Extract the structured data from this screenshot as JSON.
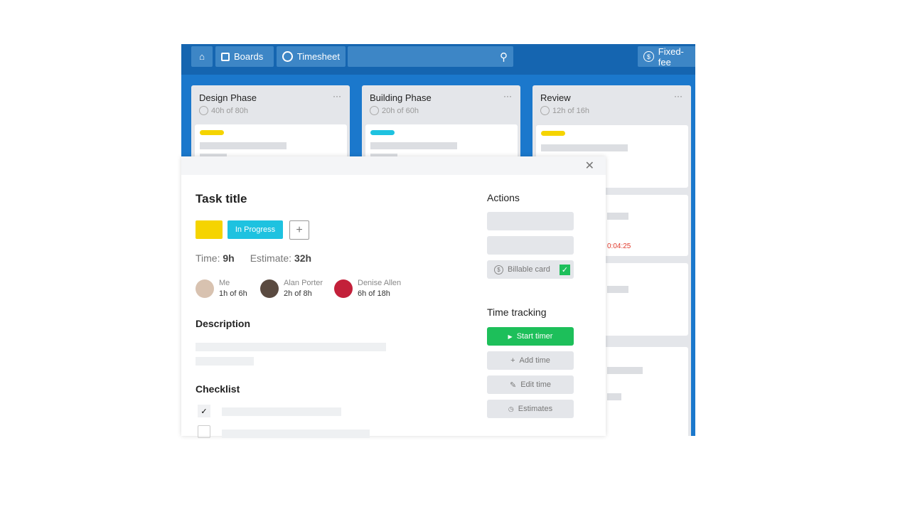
{
  "nav": {
    "boards": "Boards",
    "timesheet": "Timesheet",
    "search_placeholder": "",
    "fixed_fee": "Fixed-fee"
  },
  "lists": [
    {
      "title": "Design Phase",
      "hours": "40h of 80h",
      "label_color": "#f5d400"
    },
    {
      "title": "Building Phase",
      "hours": "20h of 60h",
      "label_color": "#1ec2e0"
    },
    {
      "title": "Review",
      "hours": "12h of 16h",
      "label_color": "#f5d400",
      "timer": "0:04:25"
    }
  ],
  "modal": {
    "title": "Task title",
    "labels": [
      {
        "text": "",
        "color": "#f5d400"
      },
      {
        "text": "In Progress",
        "color": "#1ec2e0"
      }
    ],
    "time_label": "Time:",
    "time_value": "9h",
    "estimate_label": "Estimate:",
    "estimate_value": "32h",
    "members": [
      {
        "name": "Me",
        "hours": "1h of 6h"
      },
      {
        "name": "Alan Porter",
        "hours": "2h of 8h"
      },
      {
        "name": "Denise Allen",
        "hours": "6h of 18h"
      }
    ],
    "description_heading": "Description",
    "checklist_heading": "Checklist",
    "checklist": [
      {
        "checked": true
      },
      {
        "checked": false
      }
    ],
    "actions_heading": "Actions",
    "billable_label": "Billable card",
    "billable": true,
    "time_tracking_heading": "Time tracking",
    "start_timer": "Start timer",
    "add_time": "Add time",
    "edit_time": "Edit time",
    "estimates": "Estimates"
  },
  "colors": {
    "brand": "#1b78cc",
    "green": "#1dbf5a"
  }
}
